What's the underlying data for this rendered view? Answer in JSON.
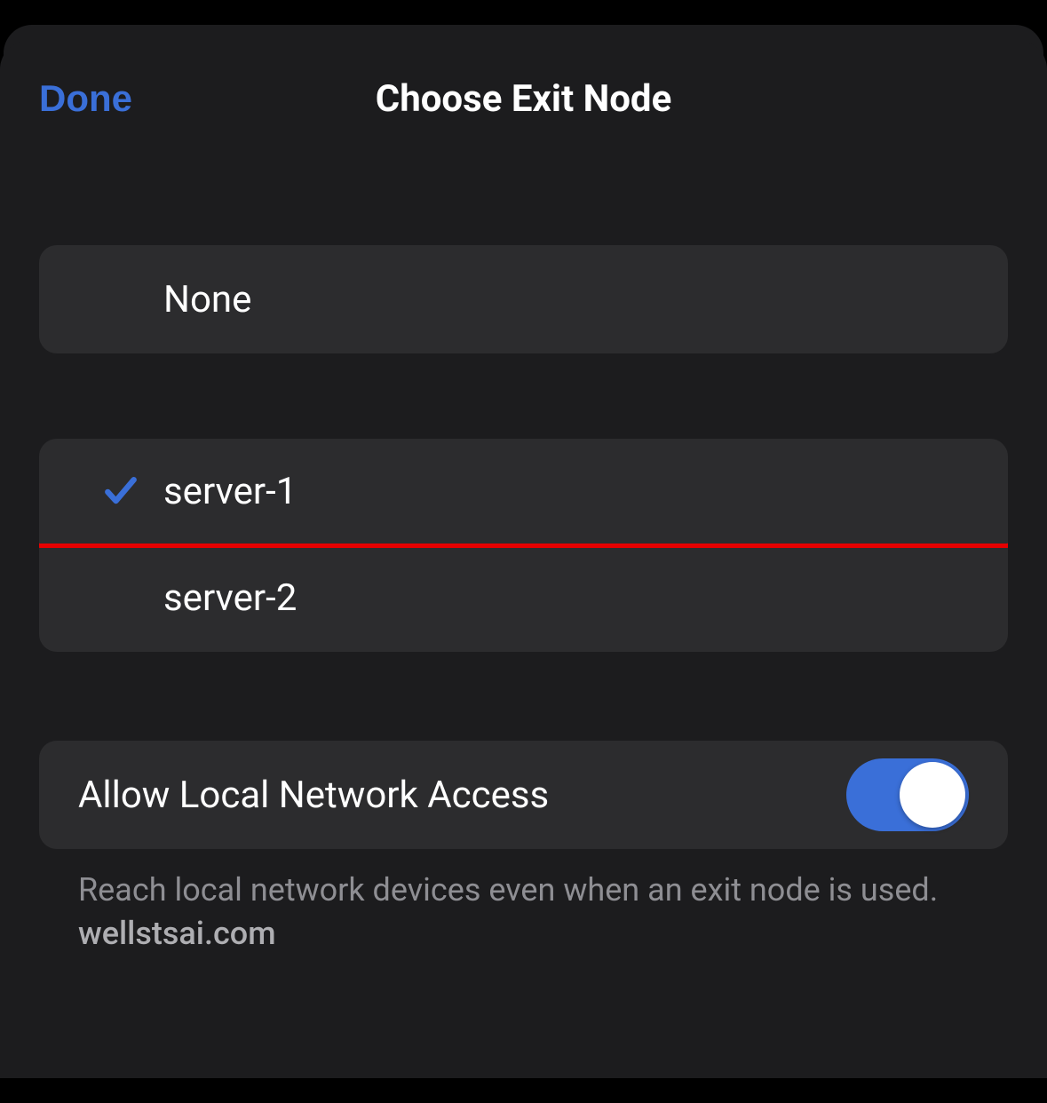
{
  "header": {
    "done_label": "Done",
    "title": "Choose Exit Node"
  },
  "none_section": {
    "label": "None",
    "selected": false
  },
  "servers": [
    {
      "label": "server-1",
      "selected": true,
      "highlighted": true
    },
    {
      "label": "server-2",
      "selected": false,
      "highlighted": false
    }
  ],
  "local_access": {
    "label": "Allow Local Network Access",
    "enabled": true,
    "footer_text": "Reach local network devices even when an exit node is used.",
    "footer_watermark": "wellstsai.com"
  },
  "colors": {
    "accent": "#3a6fd8",
    "highlight": "#e60000"
  }
}
